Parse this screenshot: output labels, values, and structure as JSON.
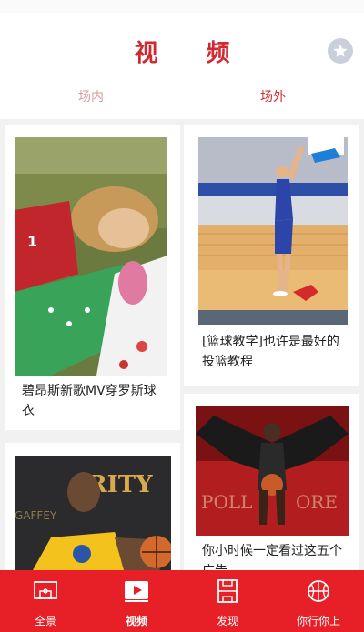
{
  "header": {
    "title": "视 频",
    "favorite_icon": "star-icon"
  },
  "tabs": [
    {
      "label": "场内",
      "active": false
    },
    {
      "label": "场外",
      "active": true
    }
  ],
  "videos": [
    {
      "title": "碧昂斯新歌MV穿罗斯球衣",
      "thumbnail": "beyonce-mv-thumbnail"
    },
    {
      "title": "[篮球教学]也许是最好的投篮教程",
      "thumbnail": "shooting-tutorial-thumbnail"
    },
    {
      "title": "",
      "thumbnail": "warriors-player-thumbnail"
    },
    {
      "title": "你小时候一定看过这五个广告",
      "thumbnail": "winged-player-thumbnail"
    }
  ],
  "bottom_nav": [
    {
      "label": "全景",
      "icon": "court-overview-icon",
      "active": false
    },
    {
      "label": "视频",
      "icon": "video-play-icon",
      "active": true
    },
    {
      "label": "发现",
      "icon": "court-discover-icon",
      "active": false
    },
    {
      "label": "你行你上",
      "icon": "basketball-icon",
      "active": false
    }
  ],
  "colors": {
    "brand_red": "#e71f26",
    "title_red": "#d2282f",
    "background": "#f1f1f1"
  }
}
